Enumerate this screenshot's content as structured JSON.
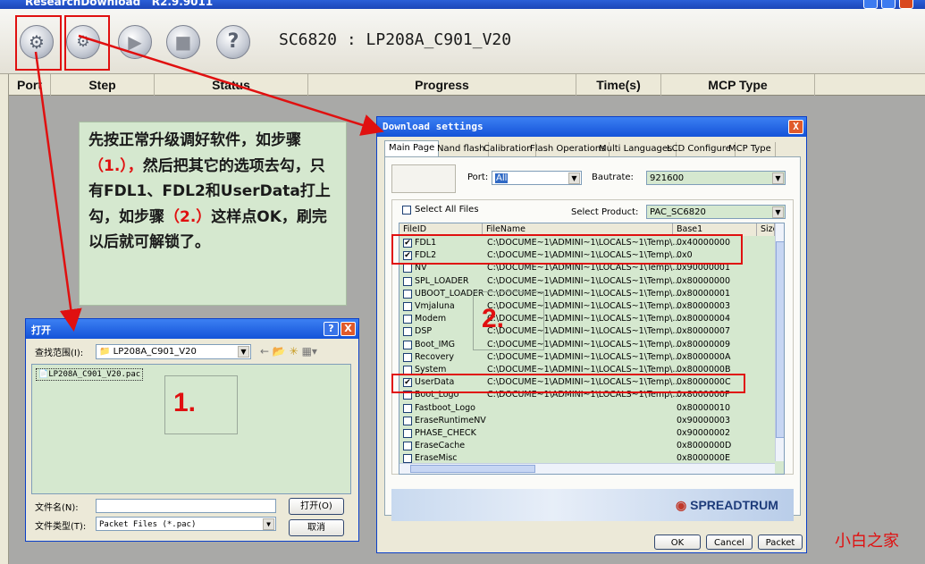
{
  "window": {
    "title": "ResearchDownload",
    "version": "R2.9.9011"
  },
  "toolbar": {
    "buttons": [
      {
        "name": "load-packet",
        "icon": "gear-icon"
      },
      {
        "name": "settings",
        "icon": "gears-icon"
      },
      {
        "name": "start",
        "icon": "play-icon"
      },
      {
        "name": "stop",
        "icon": "stop-icon"
      },
      {
        "name": "help",
        "icon": "help-icon"
      }
    ],
    "model": "SC6820 : LP208A_C901_V20"
  },
  "columns": [
    "Port",
    "Step",
    "Status",
    "Progress",
    "Time(s)",
    "MCP Type"
  ],
  "note": {
    "segments": [
      {
        "text": "先按正常升级调好软件，如步骤",
        "highlight": false
      },
      {
        "text": "（1.），",
        "highlight": true
      },
      {
        "text": "然后把其它的选项去勾，只有FDL1、FDL2和UserData打上勾，如步骤",
        "highlight": false
      },
      {
        "text": "（2.）",
        "highlight": true
      },
      {
        "text": "这样点OK，刷完以后就可解锁了。",
        "highlight": false
      }
    ]
  },
  "open_dialog": {
    "title": "打开",
    "help_button": "?",
    "close_button": "X",
    "lookin_label": "查找范围(I):",
    "lookin_value": "LP208A_C901_V20",
    "file": "LP208A_C901_V20.pac",
    "step_marker": "1.",
    "filename_label": "文件名(N):",
    "filetype_label": "文件类型(T):",
    "filetype_value": "Packet Files (*.pac)",
    "open_button": "打开(O)",
    "cancel_button": "取消"
  },
  "download_dialog": {
    "title": "Download settings",
    "close_button": "X",
    "tabs": [
      "Main Page",
      "Nand flash",
      "Calibration",
      "Flash Operations",
      "Multi Languages",
      "LCD Configure",
      "MCP Type"
    ],
    "port_label": "Port:",
    "port_value": "All",
    "baudrate_label": "Bautrate:",
    "baudrate_value": "921600",
    "select_all_label": "Select All Files",
    "select_product_label": "Select Product:",
    "select_product_value": "PAC_SC6820",
    "table_headers": [
      "FileID",
      "FileName",
      "Base1",
      "Size"
    ],
    "files": [
      {
        "id": "FDL1",
        "name": "C:\\DOCUME~1\\ADMINI~1\\LOCALS~1\\Temp\\...",
        "base": "0x40000000",
        "checked": true
      },
      {
        "id": "FDL2",
        "name": "C:\\DOCUME~1\\ADMINI~1\\LOCALS~1\\Temp\\...",
        "base": "0x0",
        "checked": true
      },
      {
        "id": "NV",
        "name": "C:\\DOCUME~1\\ADMINI~1\\LOCALS~1\\Temp\\...",
        "base": "0x90000001",
        "checked": false
      },
      {
        "id": "SPL_LOADER",
        "name": "C:\\DOCUME~1\\ADMINI~1\\LOCALS~1\\Temp\\...",
        "base": "0x80000000",
        "checked": false
      },
      {
        "id": "UBOOT_LOADER",
        "name": "C:\\DOCUME~1\\ADMINI~1\\LOCALS~1\\Temp\\...",
        "base": "0x80000001",
        "checked": false
      },
      {
        "id": "Vmjaluna",
        "name": "C:\\DOCUME~1\\ADMINI~1\\LOCALS~1\\Temp\\...",
        "base": "0x80000003",
        "checked": false
      },
      {
        "id": "Modem",
        "name": "C:\\DOCUME~1\\ADMINI~1\\LOCALS~1\\Temp\\...",
        "base": "0x80000004",
        "checked": false
      },
      {
        "id": "DSP",
        "name": "C:\\DOCUME~1\\ADMINI~1\\LOCALS~1\\Temp\\...",
        "base": "0x80000007",
        "checked": false
      },
      {
        "id": "Boot_IMG",
        "name": "C:\\DOCUME~1\\ADMINI~1\\LOCALS~1\\Temp\\...",
        "base": "0x80000009",
        "checked": false
      },
      {
        "id": "Recovery",
        "name": "C:\\DOCUME~1\\ADMINI~1\\LOCALS~1\\Temp\\...",
        "base": "0x8000000A",
        "checked": false
      },
      {
        "id": "System",
        "name": "C:\\DOCUME~1\\ADMINI~1\\LOCALS~1\\Temp\\...",
        "base": "0x8000000B",
        "checked": false
      },
      {
        "id": "UserData",
        "name": "C:\\DOCUME~1\\ADMINI~1\\LOCALS~1\\Temp\\...",
        "base": "0x8000000C",
        "checked": true
      },
      {
        "id": "Boot_Logo",
        "name": "C:\\DOCUME~1\\ADMINI~1\\LOCALS~1\\Temp\\...",
        "base": "0x8000000F",
        "checked": false
      },
      {
        "id": "Fastboot_Logo",
        "name": "",
        "base": "0x80000010",
        "checked": false
      },
      {
        "id": "EraseRuntimeNV",
        "name": "",
        "base": "0x90000003",
        "checked": false
      },
      {
        "id": "PHASE_CHECK",
        "name": "",
        "base": "0x90000002",
        "checked": false
      },
      {
        "id": "EraseCache",
        "name": "",
        "base": "0x8000000D",
        "checked": false
      },
      {
        "id": "EraseMisc",
        "name": "",
        "base": "0x8000000E",
        "checked": false
      }
    ],
    "step_marker": "2.",
    "brand": "SPREADTRUM",
    "ok_button": "OK",
    "cancel_button": "Cancel",
    "packet_button": "Packet"
  },
  "watermark": "小白之家",
  "colors": {
    "annotation_red": "#e01010",
    "note_bg": "#d5e8cf",
    "titlebar": "#1453d8"
  }
}
